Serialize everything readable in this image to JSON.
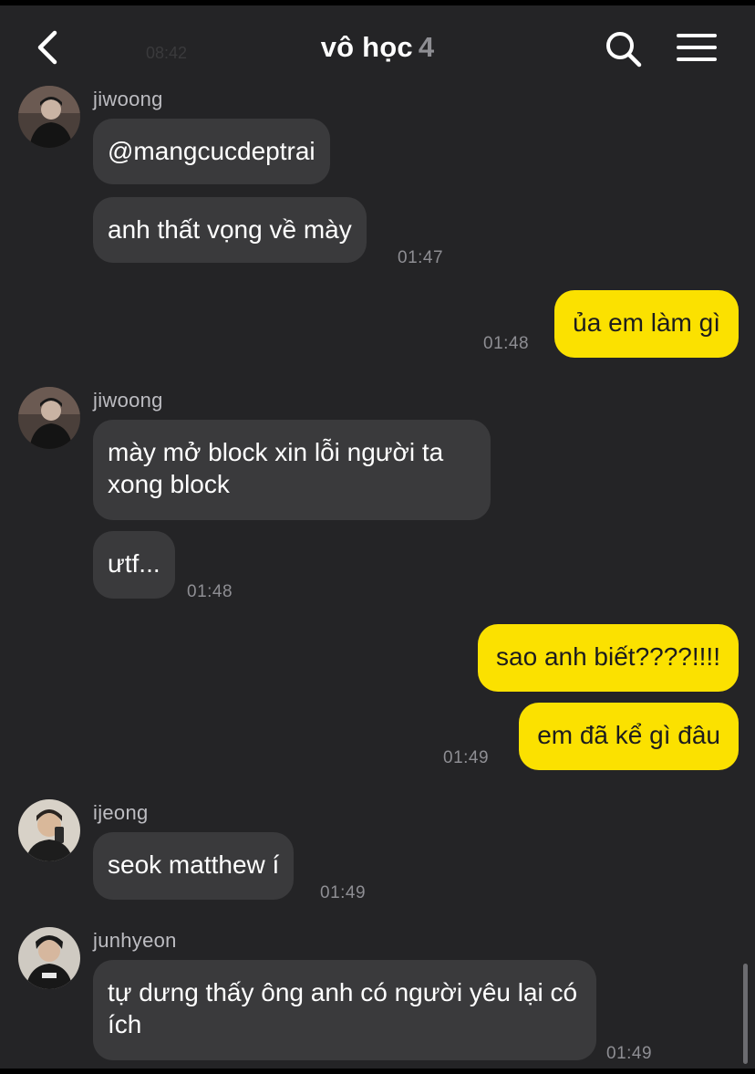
{
  "header": {
    "title": "vô học",
    "member_count": "4",
    "ghost_time": "08:42",
    "back_icon": "chevron-left-icon",
    "search_icon": "search-icon",
    "menu_icon": "hamburger-menu-icon"
  },
  "colors": {
    "background": "#242426",
    "incoming_bubble": "#3a3a3c",
    "outgoing_bubble": "#fbe100"
  },
  "messages": [
    {
      "sender": "jiwoong",
      "text": "@mangcucdeptrai",
      "time": ""
    },
    {
      "sender": "jiwoong",
      "text": "anh thất vọng về mày",
      "time": "01:47"
    },
    {
      "sender": "me",
      "text": "ủa em làm gì",
      "time": "01:48"
    },
    {
      "sender": "jiwoong",
      "text": "mày mở block xin lỗi người ta xong block",
      "time": ""
    },
    {
      "sender": "jiwoong",
      "text": "ưtf...",
      "time": "01:48"
    },
    {
      "sender": "me",
      "text": "sao anh biết????!!!!",
      "time": ""
    },
    {
      "sender": "me",
      "text": "em đã kể gì đâu",
      "time": "01:49"
    },
    {
      "sender": "ijeong",
      "text": "seok matthew í",
      "time": "01:49"
    },
    {
      "sender": "junhyeon",
      "text": "tự dưng thấy ông anh có người yêu lại có ích",
      "time": "01:49"
    }
  ]
}
